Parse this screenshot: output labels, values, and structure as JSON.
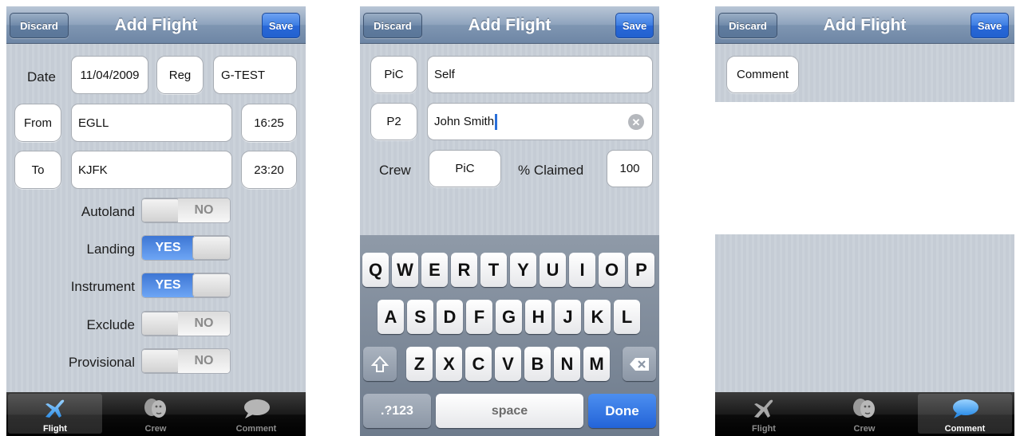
{
  "nav": {
    "title": "Add Flight",
    "discard": "Discard",
    "save": "Save"
  },
  "tabs": [
    "Flight",
    "Crew",
    "Comment"
  ],
  "flight": {
    "date_label": "Date",
    "date_value": "11/04/2009",
    "reg_label": "Reg",
    "reg_value": "G-TEST",
    "from_label": "From",
    "from_value": "EGLL",
    "from_time": "16:25",
    "to_label": "To",
    "to_value": "KJFK",
    "to_time": "23:20",
    "toggles": [
      {
        "label": "Autoland",
        "state": "NO"
      },
      {
        "label": "Landing",
        "state": "YES"
      },
      {
        "label": "Instrument",
        "state": "YES"
      },
      {
        "label": "Exclude",
        "state": "NO"
      },
      {
        "label": "Provisional",
        "state": "NO"
      }
    ]
  },
  "crew": {
    "pic_label": "PiC",
    "pic_value": "Self",
    "p2_label": "P2",
    "p2_value": "John Smith",
    "crew_label": "Crew",
    "crew_value": "PiC",
    "claimed_label": "% Claimed",
    "claimed_value": "100"
  },
  "keyboard": {
    "row1": [
      "Q",
      "W",
      "E",
      "R",
      "T",
      "Y",
      "U",
      "I",
      "O",
      "P"
    ],
    "row2": [
      "A",
      "S",
      "D",
      "F",
      "G",
      "H",
      "J",
      "K",
      "L"
    ],
    "row3": [
      "Z",
      "X",
      "C",
      "V",
      "B",
      "N",
      "M"
    ],
    "numbers": ".?123",
    "space": "space",
    "done": "Done"
  },
  "comment": {
    "label": "Comment"
  },
  "colors": {
    "accent": "#2a6fd9",
    "toggle_on": "#4f8ae6",
    "tab_bar": "#111111"
  },
  "icons": {
    "flight": "airplane-icon",
    "crew": "crew-faces-icon",
    "comment": "speech-bubble-icon",
    "clear": "clear-x-icon",
    "shift": "shift-arrow-icon",
    "backspace": "backspace-icon"
  }
}
